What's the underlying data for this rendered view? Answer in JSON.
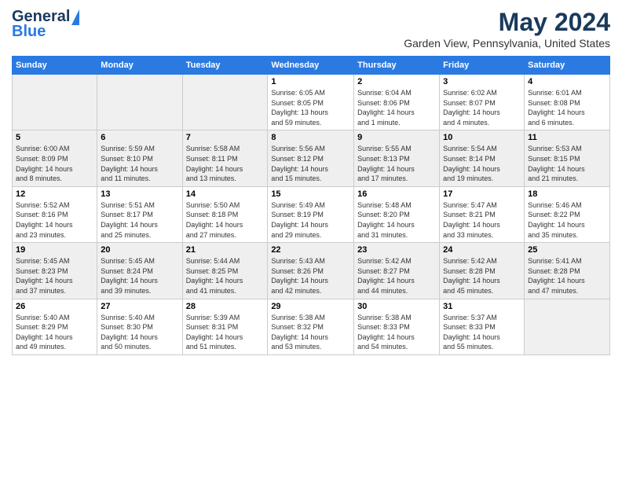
{
  "header": {
    "logo_general": "General",
    "logo_blue": "Blue",
    "month": "May 2024",
    "location": "Garden View, Pennsylvania, United States"
  },
  "days_of_week": [
    "Sunday",
    "Monday",
    "Tuesday",
    "Wednesday",
    "Thursday",
    "Friday",
    "Saturday"
  ],
  "weeks": [
    [
      {
        "day": "",
        "info": ""
      },
      {
        "day": "",
        "info": ""
      },
      {
        "day": "",
        "info": ""
      },
      {
        "day": "1",
        "info": "Sunrise: 6:05 AM\nSunset: 8:05 PM\nDaylight: 13 hours\nand 59 minutes."
      },
      {
        "day": "2",
        "info": "Sunrise: 6:04 AM\nSunset: 8:06 PM\nDaylight: 14 hours\nand 1 minute."
      },
      {
        "day": "3",
        "info": "Sunrise: 6:02 AM\nSunset: 8:07 PM\nDaylight: 14 hours\nand 4 minutes."
      },
      {
        "day": "4",
        "info": "Sunrise: 6:01 AM\nSunset: 8:08 PM\nDaylight: 14 hours\nand 6 minutes."
      }
    ],
    [
      {
        "day": "5",
        "info": "Sunrise: 6:00 AM\nSunset: 8:09 PM\nDaylight: 14 hours\nand 8 minutes."
      },
      {
        "day": "6",
        "info": "Sunrise: 5:59 AM\nSunset: 8:10 PM\nDaylight: 14 hours\nand 11 minutes."
      },
      {
        "day": "7",
        "info": "Sunrise: 5:58 AM\nSunset: 8:11 PM\nDaylight: 14 hours\nand 13 minutes."
      },
      {
        "day": "8",
        "info": "Sunrise: 5:56 AM\nSunset: 8:12 PM\nDaylight: 14 hours\nand 15 minutes."
      },
      {
        "day": "9",
        "info": "Sunrise: 5:55 AM\nSunset: 8:13 PM\nDaylight: 14 hours\nand 17 minutes."
      },
      {
        "day": "10",
        "info": "Sunrise: 5:54 AM\nSunset: 8:14 PM\nDaylight: 14 hours\nand 19 minutes."
      },
      {
        "day": "11",
        "info": "Sunrise: 5:53 AM\nSunset: 8:15 PM\nDaylight: 14 hours\nand 21 minutes."
      }
    ],
    [
      {
        "day": "12",
        "info": "Sunrise: 5:52 AM\nSunset: 8:16 PM\nDaylight: 14 hours\nand 23 minutes."
      },
      {
        "day": "13",
        "info": "Sunrise: 5:51 AM\nSunset: 8:17 PM\nDaylight: 14 hours\nand 25 minutes."
      },
      {
        "day": "14",
        "info": "Sunrise: 5:50 AM\nSunset: 8:18 PM\nDaylight: 14 hours\nand 27 minutes."
      },
      {
        "day": "15",
        "info": "Sunrise: 5:49 AM\nSunset: 8:19 PM\nDaylight: 14 hours\nand 29 minutes."
      },
      {
        "day": "16",
        "info": "Sunrise: 5:48 AM\nSunset: 8:20 PM\nDaylight: 14 hours\nand 31 minutes."
      },
      {
        "day": "17",
        "info": "Sunrise: 5:47 AM\nSunset: 8:21 PM\nDaylight: 14 hours\nand 33 minutes."
      },
      {
        "day": "18",
        "info": "Sunrise: 5:46 AM\nSunset: 8:22 PM\nDaylight: 14 hours\nand 35 minutes."
      }
    ],
    [
      {
        "day": "19",
        "info": "Sunrise: 5:45 AM\nSunset: 8:23 PM\nDaylight: 14 hours\nand 37 minutes."
      },
      {
        "day": "20",
        "info": "Sunrise: 5:45 AM\nSunset: 8:24 PM\nDaylight: 14 hours\nand 39 minutes."
      },
      {
        "day": "21",
        "info": "Sunrise: 5:44 AM\nSunset: 8:25 PM\nDaylight: 14 hours\nand 41 minutes."
      },
      {
        "day": "22",
        "info": "Sunrise: 5:43 AM\nSunset: 8:26 PM\nDaylight: 14 hours\nand 42 minutes."
      },
      {
        "day": "23",
        "info": "Sunrise: 5:42 AM\nSunset: 8:27 PM\nDaylight: 14 hours\nand 44 minutes."
      },
      {
        "day": "24",
        "info": "Sunrise: 5:42 AM\nSunset: 8:28 PM\nDaylight: 14 hours\nand 45 minutes."
      },
      {
        "day": "25",
        "info": "Sunrise: 5:41 AM\nSunset: 8:28 PM\nDaylight: 14 hours\nand 47 minutes."
      }
    ],
    [
      {
        "day": "26",
        "info": "Sunrise: 5:40 AM\nSunset: 8:29 PM\nDaylight: 14 hours\nand 49 minutes."
      },
      {
        "day": "27",
        "info": "Sunrise: 5:40 AM\nSunset: 8:30 PM\nDaylight: 14 hours\nand 50 minutes."
      },
      {
        "day": "28",
        "info": "Sunrise: 5:39 AM\nSunset: 8:31 PM\nDaylight: 14 hours\nand 51 minutes."
      },
      {
        "day": "29",
        "info": "Sunrise: 5:38 AM\nSunset: 8:32 PM\nDaylight: 14 hours\nand 53 minutes."
      },
      {
        "day": "30",
        "info": "Sunrise: 5:38 AM\nSunset: 8:33 PM\nDaylight: 14 hours\nand 54 minutes."
      },
      {
        "day": "31",
        "info": "Sunrise: 5:37 AM\nSunset: 8:33 PM\nDaylight: 14 hours\nand 55 minutes."
      },
      {
        "day": "",
        "info": ""
      }
    ]
  ]
}
